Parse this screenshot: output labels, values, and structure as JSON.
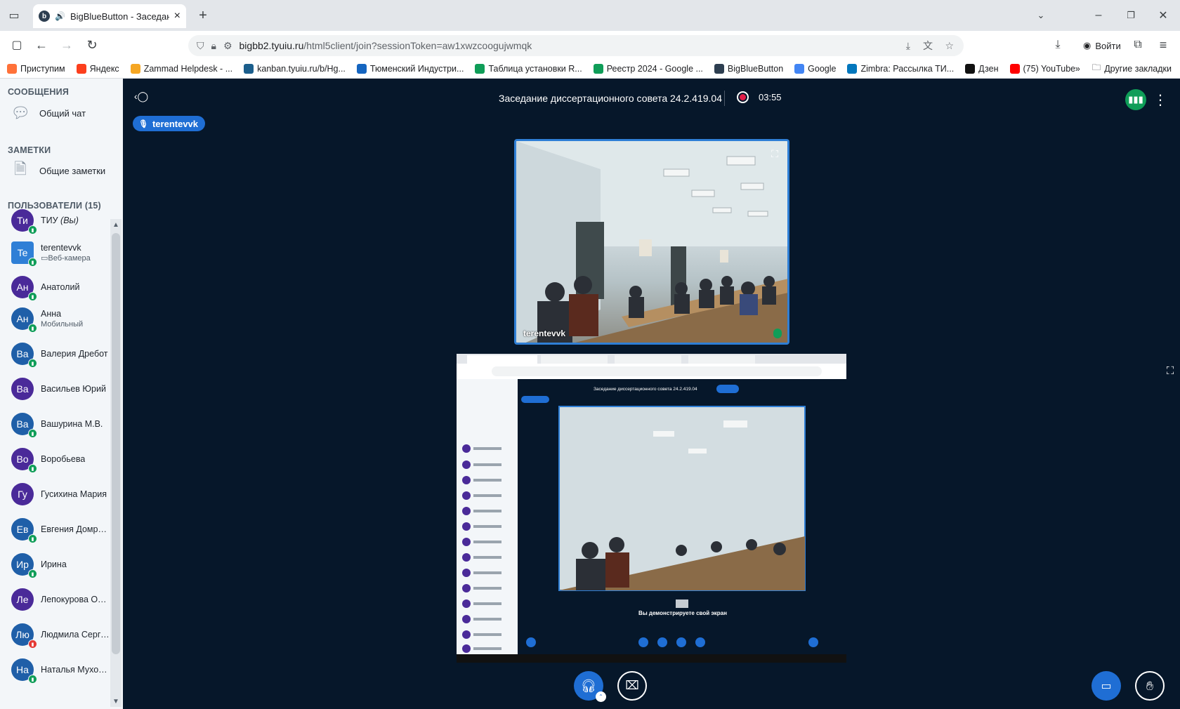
{
  "browser": {
    "tab_title": "BigBlueButton - Заседание",
    "tab_close": "×",
    "new_tab": "+",
    "url_host": "bigbb2.tyuiu.ru",
    "url_path": "/html5client/join?sessionToken=aw1xwzcoogujwmqk",
    "signin_label": "Войти",
    "bookmarks": [
      {
        "label": "Приступим",
        "color": "#ff7139"
      },
      {
        "label": "Яндекс",
        "color": "#fc3f1d"
      },
      {
        "label": "Zammad Helpdesk - ...",
        "color": "#f5a623"
      },
      {
        "label": "kanban.tyuiu.ru/b/Hg...",
        "color": "#1b5e8c"
      },
      {
        "label": "Тюменский Индустри...",
        "color": "#1565c0"
      },
      {
        "label": "Таблица установки R...",
        "color": "#0f9d58"
      },
      {
        "label": "Реестр 2024 - Google ...",
        "color": "#0f9d58"
      },
      {
        "label": "BigBlueButton",
        "color": "#2d3e50"
      },
      {
        "label": "Google",
        "color": "#4285f4"
      },
      {
        "label": "Zimbra: Рассылка ТИ...",
        "color": "#0277bd"
      },
      {
        "label": "Дзен",
        "color": "#111111"
      },
      {
        "label": "(75) YouTube",
        "color": "#ff0000"
      }
    ],
    "other_bookmarks": "Другие закладки"
  },
  "sidebar": {
    "messages_title": "СООБЩЕНИЯ",
    "public_chat": "Общий чат",
    "notes_title": "ЗАМЕТКИ",
    "shared_notes": "Общие заметки",
    "users_title": "ПОЛЬЗОВАТЕЛИ (15)",
    "users": [
      {
        "initials": "Ти",
        "name": "ТИУ",
        "suffix": "(Вы)",
        "sub": "",
        "color": "#4a2a99",
        "mic": "on"
      },
      {
        "initials": "Te",
        "name": "terentevvk",
        "suffix": "",
        "sub": "Веб-камера",
        "color": "#2f7fd6",
        "mic": "on"
      },
      {
        "initials": "Ан",
        "name": "Анатолий",
        "suffix": "",
        "sub": "",
        "color": "#4a2a99",
        "mic": "on"
      },
      {
        "initials": "Ан",
        "name": "Анна",
        "suffix": "",
        "sub": "Мобильный",
        "color": "#1f5fa8",
        "mic": "on"
      },
      {
        "initials": "Ва",
        "name": "Валерия Дребот",
        "suffix": "",
        "sub": "",
        "color": "#1f5fa8",
        "mic": "on"
      },
      {
        "initials": "Ва",
        "name": "Васильев Юрий",
        "suffix": "",
        "sub": "",
        "color": "#4a2a99",
        "mic": "none"
      },
      {
        "initials": "Ва",
        "name": "Вашурина М.В.",
        "suffix": "",
        "sub": "",
        "color": "#1f5fa8",
        "mic": "on"
      },
      {
        "initials": "Во",
        "name": "Воробьева",
        "suffix": "",
        "sub": "",
        "color": "#4a2a99",
        "mic": "on"
      },
      {
        "initials": "Гу",
        "name": "Гусихина Мария",
        "suffix": "",
        "sub": "",
        "color": "#4a2a99",
        "mic": "none"
      },
      {
        "initials": "Ев",
        "name": "Евгения Домроч...",
        "suffix": "",
        "sub": "",
        "color": "#1f5fa8",
        "mic": "on"
      },
      {
        "initials": "Ир",
        "name": "Ирина",
        "suffix": "",
        "sub": "",
        "color": "#1f5fa8",
        "mic": "on"
      },
      {
        "initials": "Ле",
        "name": "Лепокурова Оле...",
        "suffix": "",
        "sub": "",
        "color": "#4a2a99",
        "mic": "none"
      },
      {
        "initials": "Лю",
        "name": "Людмила Серге...",
        "suffix": "",
        "sub": "",
        "color": "#1f5fa8",
        "mic": "muted"
      },
      {
        "initials": "На",
        "name": "Наталья Мухорт...",
        "suffix": "",
        "sub": "",
        "color": "#1f5fa8",
        "mic": "on"
      }
    ]
  },
  "meeting": {
    "title": "Заседание диссертационного совета 24.2.419.04",
    "timer": "03:55",
    "talking_user": "terentevvk",
    "webcam_name": "terentevvk"
  },
  "screenshare": {
    "mini_title": "Заседание диссертационного совета 24.2.419.04",
    "sharing_notice": "Вы демонстрируете свой экран"
  },
  "colors": {
    "accent": "#1f6ed4",
    "main_bg": "#06172a",
    "sidebar_bg": "#f3f6f9",
    "recording": "#e11d48",
    "mic_on": "#0f9d58"
  }
}
